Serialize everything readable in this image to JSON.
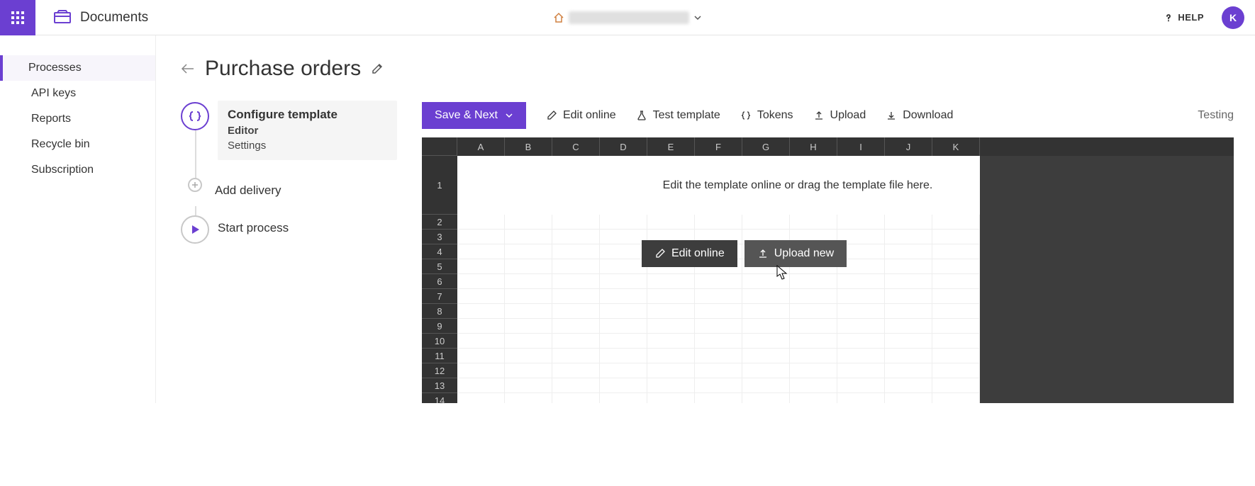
{
  "header": {
    "section": "Documents",
    "help": "HELP",
    "avatar_initial": "K"
  },
  "sidebar": {
    "items": [
      {
        "label": "Processes",
        "active": true
      },
      {
        "label": "API keys"
      },
      {
        "label": "Reports"
      },
      {
        "label": "Recycle bin"
      },
      {
        "label": "Subscription"
      }
    ]
  },
  "page": {
    "title": "Purchase orders"
  },
  "steps": {
    "configure": {
      "title": "Configure template",
      "sub1": "Editor",
      "sub2": "Settings"
    },
    "delivery": {
      "title": "Add delivery"
    },
    "start": {
      "title": "Start process"
    }
  },
  "toolbar": {
    "save": "Save & Next",
    "edit": "Edit online",
    "test": "Test template",
    "tokens": "Tokens",
    "upload": "Upload",
    "download": "Download",
    "testing": "Testing"
  },
  "sheet": {
    "columns": [
      "A",
      "B",
      "C",
      "D",
      "E",
      "F",
      "G",
      "H",
      "I",
      "J",
      "K"
    ],
    "rows": [
      "1",
      "2",
      "3",
      "4",
      "5",
      "6",
      "7",
      "8",
      "9",
      "10",
      "11",
      "12",
      "13",
      "14"
    ],
    "message": "Edit the template online or drag the template file here.",
    "btn_edit": "Edit online",
    "btn_upload": "Upload new"
  }
}
